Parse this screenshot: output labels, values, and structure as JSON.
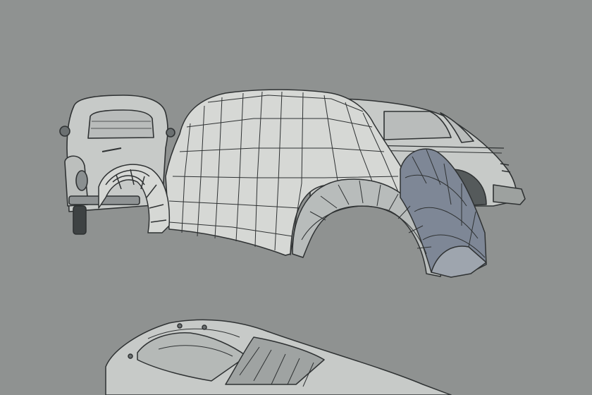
{
  "viewport": {
    "background": "#8f9291",
    "model_fill_light": "#d6d8d5",
    "model_fill_mid": "#b8bcbb",
    "model_fill_dark": "#7e8796",
    "line_color": "#2f3233",
    "reference_fill": "#c7cac8"
  }
}
